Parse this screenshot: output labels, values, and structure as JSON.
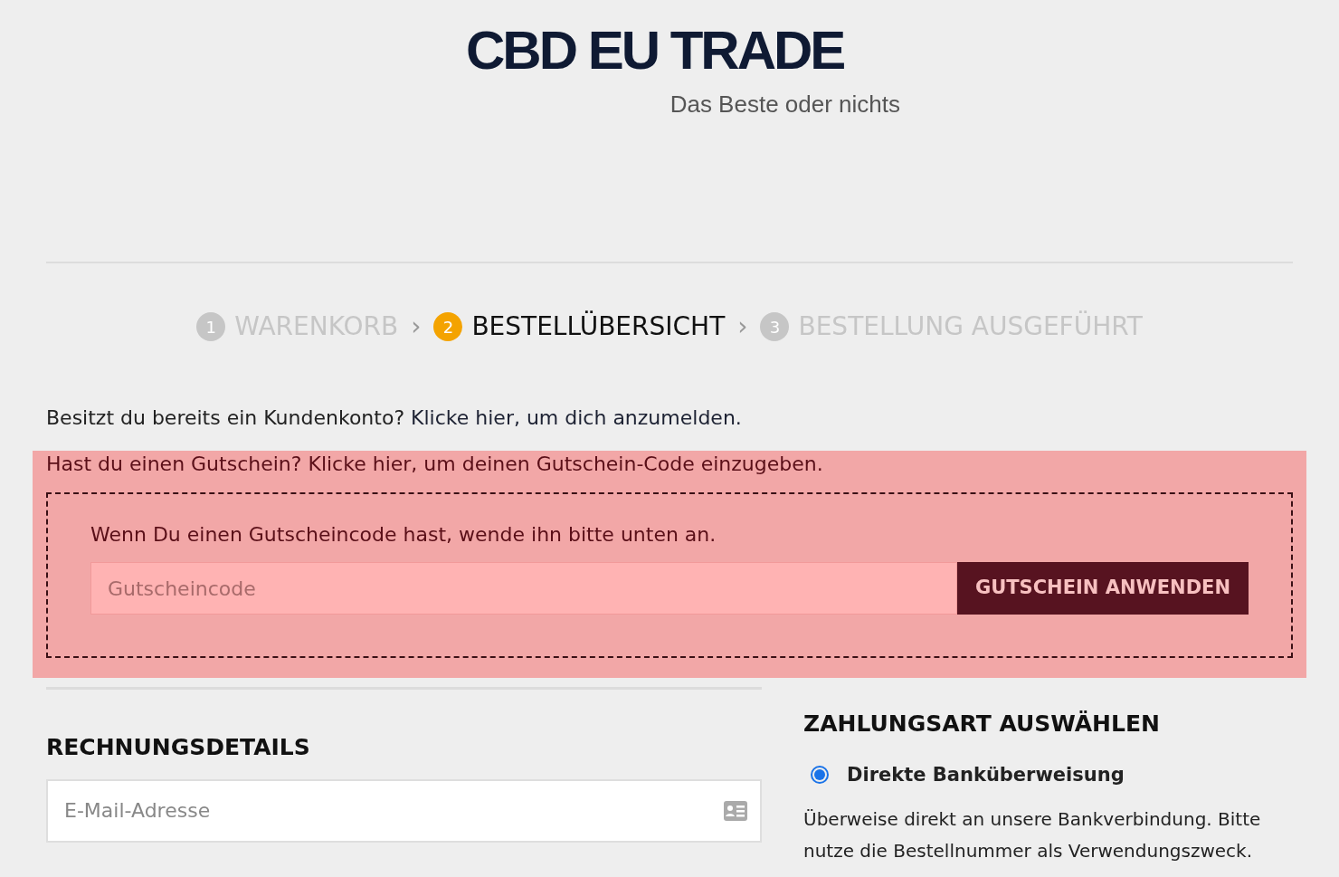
{
  "logo": {
    "title": "CBD EU TRADE",
    "tagline": "Das Beste oder nichts"
  },
  "steps": [
    {
      "number": "1",
      "label": "WARENKORB",
      "selected": false,
      "separator": "›"
    },
    {
      "number": "2",
      "label": "BESTELLÜBERSICHT",
      "selected": true,
      "separator": "›"
    },
    {
      "number": "3",
      "label": "BESTELLUNG AUSGEFÜHRT",
      "selected": false
    }
  ],
  "login_notice": {
    "text": "Besitzt du bereits ein Kundenkonto?",
    "link": "Klicke hier, um dich anzumelden."
  },
  "coupon": {
    "text": "Hast du einen Gutschein?",
    "link": "Klicke hier, um deinen Gutschein-Code einzugeben.",
    "hint": "Wenn Du einen Gutscheincode hast, wende ihn bitte unten an.",
    "placeholder": "Gutscheincode",
    "button": "GUTSCHEIN ANWENDEN"
  },
  "billing": {
    "title": "RECHNUNGSDETAILS",
    "email_placeholder": "E-Mail-Adresse"
  },
  "payment": {
    "title": "ZAHLUNGSART AUSWÄHLEN",
    "methods": [
      {
        "label": "Direkte Banküberweisung",
        "selected": true,
        "description": "Überweise direkt an unsere Bankverbindung. Bitte nutze die Bestellnummer als Verwendungszweck."
      }
    ]
  }
}
